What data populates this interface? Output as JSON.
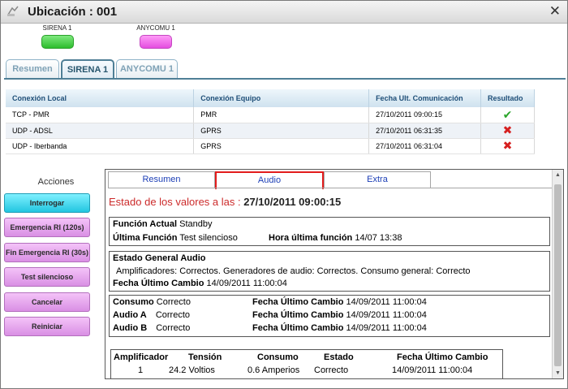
{
  "window": {
    "title": "Ubicación : 001",
    "close_glyph": "✕"
  },
  "devices": [
    {
      "label": "SIRENA 1",
      "color": "#2ebd2e"
    },
    {
      "label": "ANYCOMU 1",
      "color": "#e44ee0"
    }
  ],
  "tabs": [
    {
      "label": "Resumen",
      "active": false
    },
    {
      "label": "SIRENA 1",
      "active": true
    },
    {
      "label": "ANYCOMU 1",
      "active": false
    }
  ],
  "connections": {
    "headers": [
      "Conexión Local",
      "Conexión Equipo",
      "Fecha Ult. Comunicación",
      "Resultado"
    ],
    "rows": [
      {
        "local": "TCP - PMR",
        "equipo": "PMR",
        "fecha": "27/10/2011 09:00:15",
        "resultado": "✔",
        "status": "ok"
      },
      {
        "local": "UDP - ADSL",
        "equipo": "GPRS",
        "fecha": "27/10/2011 06:31:35",
        "resultado": "✖",
        "status": "error"
      },
      {
        "local": "UDP - Iberbanda",
        "equipo": "GPRS",
        "fecha": "27/10/2011 06:31:04",
        "resultado": "✖",
        "status": "error"
      }
    ]
  },
  "acciones": {
    "title": "Acciones",
    "buttons": [
      {
        "label": "Interrogar",
        "style": "cyan"
      },
      {
        "label": "Emergencia RI (120s)",
        "style": "pink"
      },
      {
        "label": "Fin Emergencia RI (30s)",
        "style": "pink"
      },
      {
        "label": "Test silencioso",
        "style": "pink"
      },
      {
        "label": "Cancelar",
        "style": "pink"
      },
      {
        "label": "Reiniciar",
        "style": "pink"
      }
    ]
  },
  "detail": {
    "tabs": [
      {
        "label": "Resumen",
        "active": false
      },
      {
        "label": "Audio",
        "active": true
      },
      {
        "label": "Extra",
        "active": false
      }
    ],
    "estado_label": "Estado de los valores a las :",
    "estado_time": "27/10/2011 09:00:15",
    "funcion_actual_label": "Función Actual",
    "funcion_actual_value": "Standby",
    "ultima_funcion_label": "Última Función",
    "ultima_funcion_value": "Test silencioso",
    "hora_ultima_label": "Hora última función",
    "hora_ultima_value": "14/07 13:38",
    "estado_general_label": "Estado General Audio",
    "estado_general_text": "Amplificadores: Correctos. Generadores de audio: Correctos. Consumo general: Correcto",
    "fecha_cambio_label": "Fecha Último Cambio",
    "fecha_cambio_value": "14/09/2011 11:00:04",
    "audio_rows": [
      {
        "name": "Consumo",
        "value": "Correcto",
        "fecha_label": "Fecha Último Cambio",
        "fecha": "14/09/2011 11:00:04"
      },
      {
        "name": "Audio A",
        "value": "Correcto",
        "fecha_label": "Fecha Último Cambio",
        "fecha": "14/09/2011 11:00:04"
      },
      {
        "name": "Audio B",
        "value": "Correcto",
        "fecha_label": "Fecha Último Cambio",
        "fecha": "14/09/2011 11:00:04"
      }
    ],
    "amp_table": {
      "headers": [
        "Amplificador",
        "Tensión",
        "Consumo",
        "Estado",
        "Fecha Último Cambio"
      ],
      "rows": [
        [
          "1",
          "24.2 Voltios",
          "0.6 Amperios",
          "Correcto",
          "14/09/2011 11:00:04"
        ]
      ]
    }
  }
}
